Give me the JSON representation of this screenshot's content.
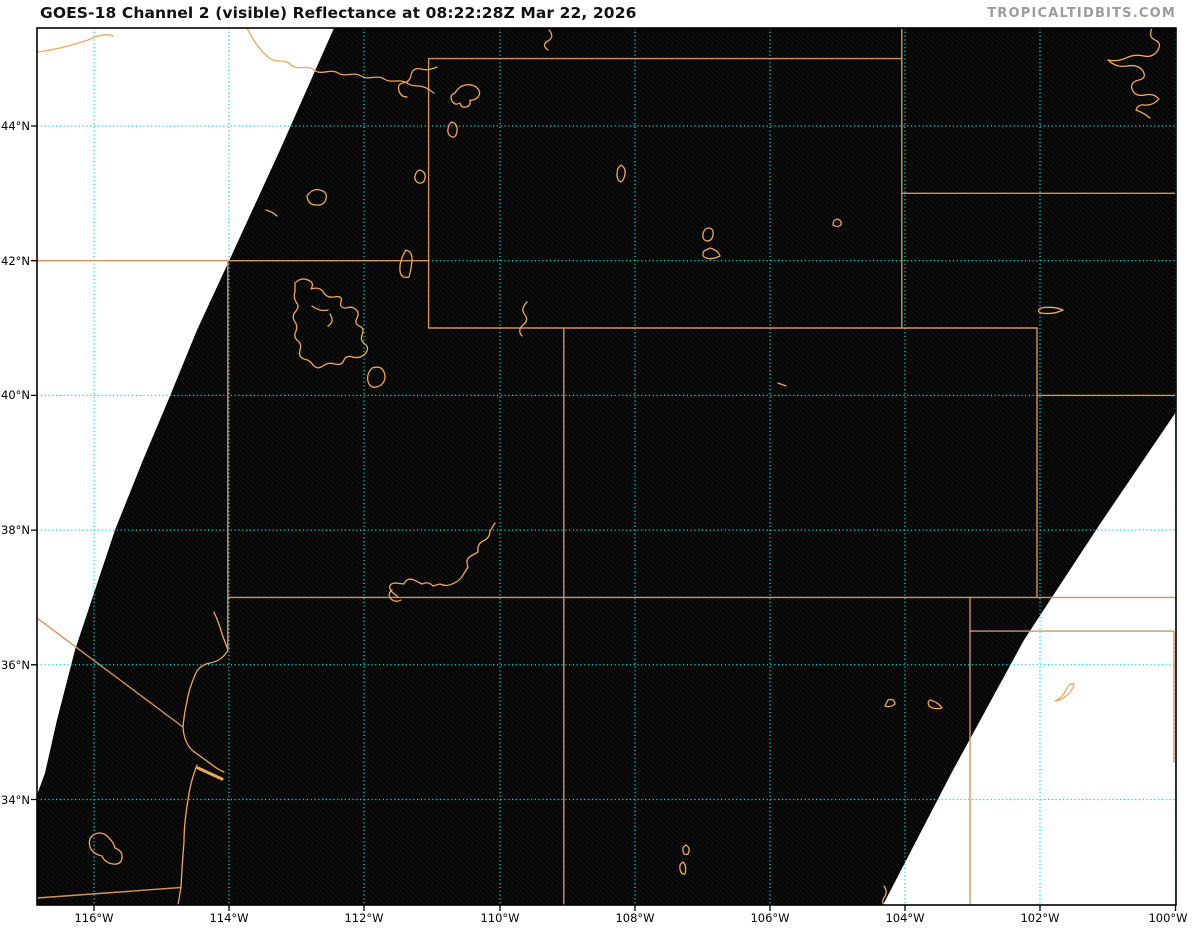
{
  "header": {
    "title": "GOES-18 Channel 2 (visible) Reflectance at 08:22:28Z Mar 22, 2026",
    "watermark": "TROPICALTIDBITS.COM"
  },
  "axes": {
    "lat_tick_labels": [
      "44°N",
      "42°N",
      "40°N",
      "38°N",
      "36°N",
      "34°N"
    ],
    "lon_tick_labels": [
      "116°W",
      "114°W",
      "112°W",
      "110°W",
      "108°W",
      "106°W",
      "104°W",
      "102°W",
      "100°W"
    ]
  },
  "colors": {
    "title": "#111111",
    "watermark": "#9c9c9c",
    "grid": "#00dcdc",
    "state-border": "#d2945e",
    "water": "#eda75f",
    "swath": "#050505"
  }
}
